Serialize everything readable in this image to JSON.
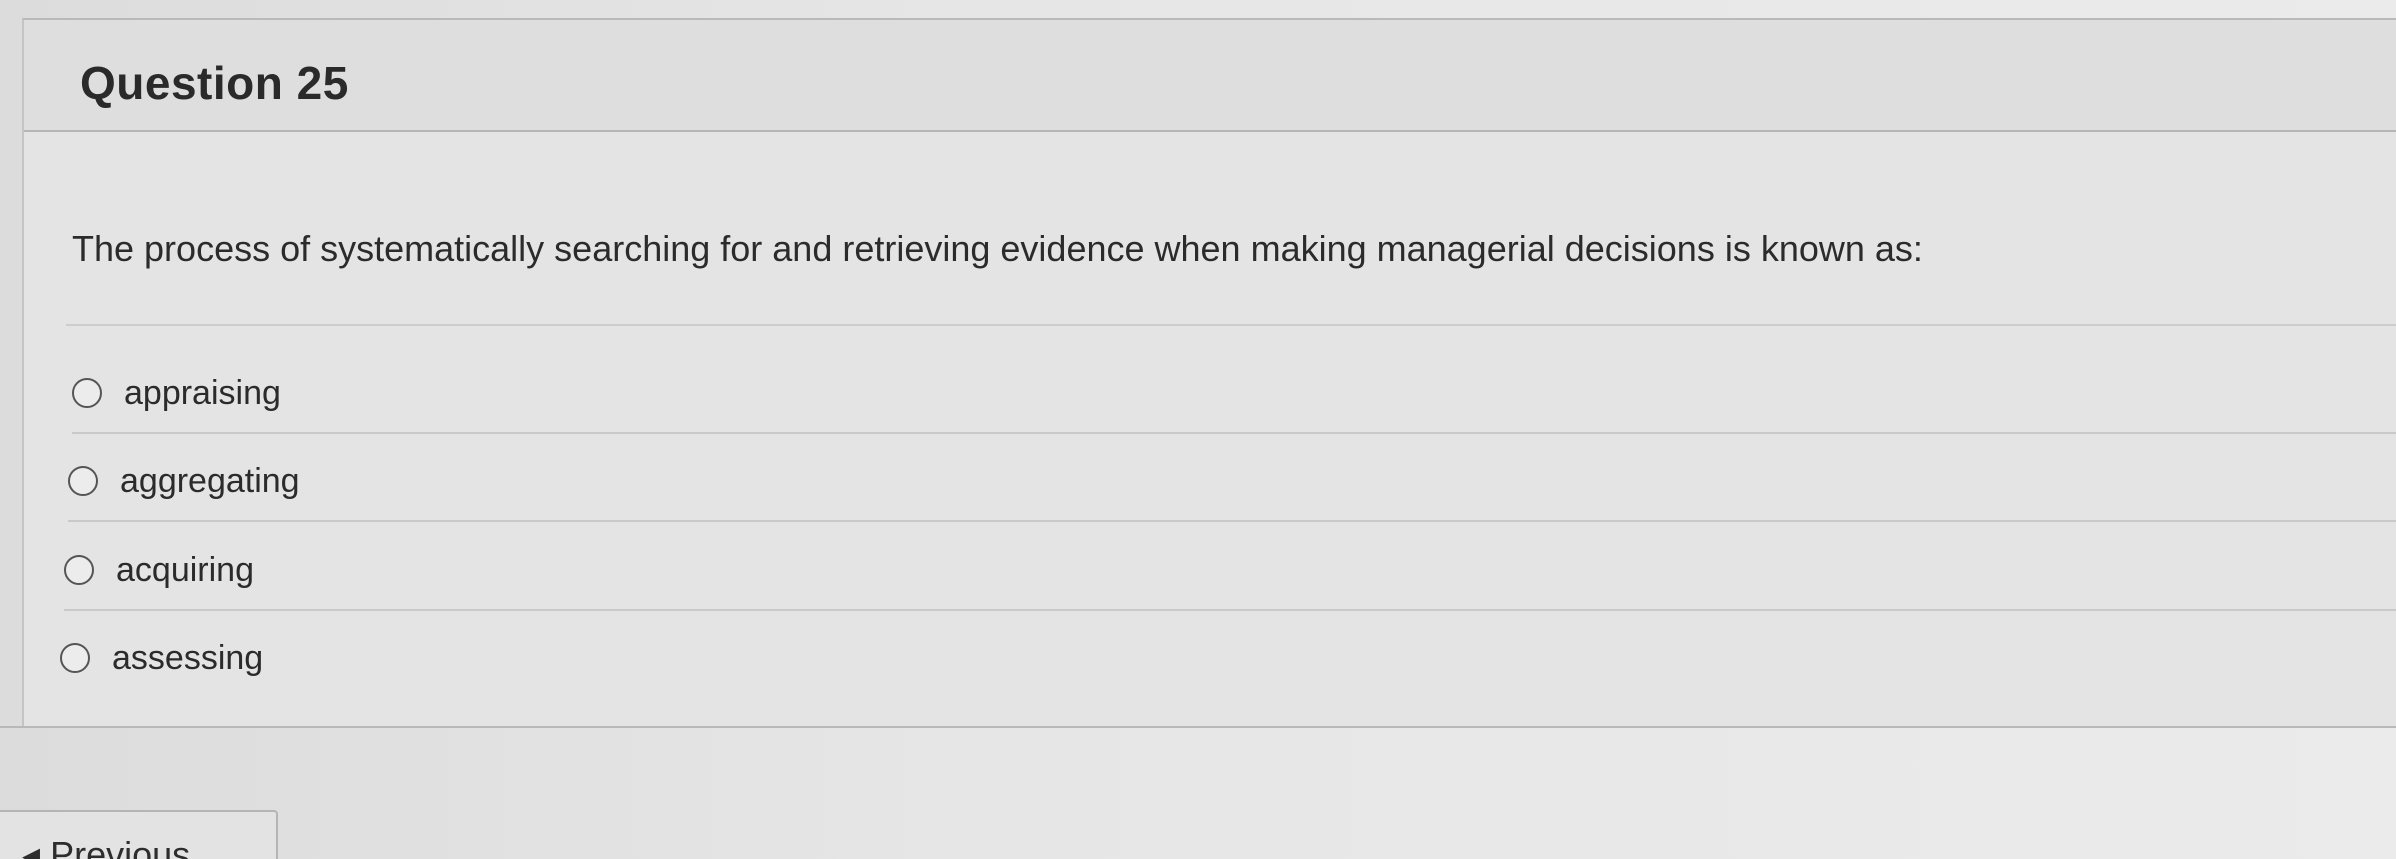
{
  "question": {
    "title": "Question 25",
    "prompt": "The process of systematically searching for and retrieving evidence when making managerial decisions is known as:",
    "options": [
      {
        "label": "appraising",
        "selected": false
      },
      {
        "label": "aggregating",
        "selected": false
      },
      {
        "label": "acquiring",
        "selected": false
      },
      {
        "label": "assessing",
        "selected": false
      }
    ]
  },
  "navigation": {
    "previous_label": "Previous",
    "previous_arrow": "◂"
  }
}
